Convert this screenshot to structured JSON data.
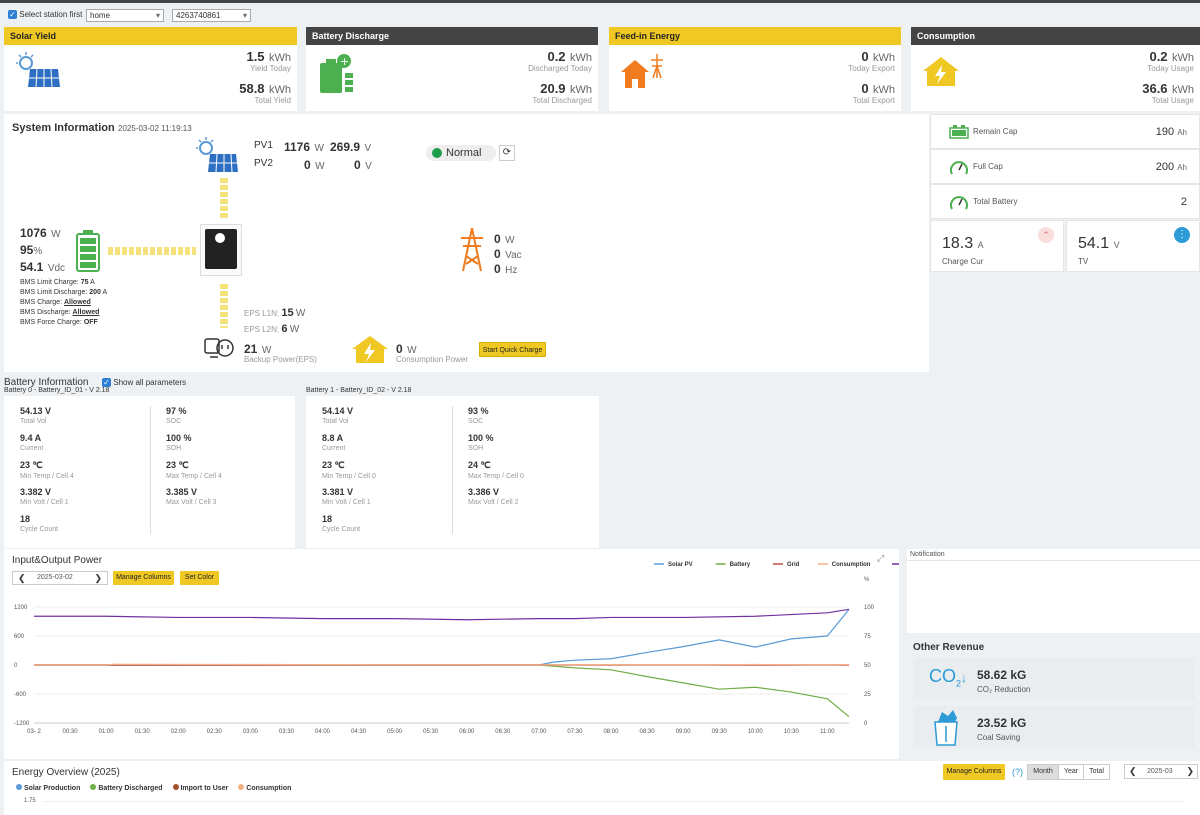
{
  "header": {
    "select_label": "Select station first",
    "station": "home",
    "serial": "4263740861"
  },
  "cards": [
    {
      "title": "Solar Yield",
      "v1": "1.5",
      "u1": "kWh",
      "l1": "Yield Today",
      "v2": "58.8",
      "u2": "kWh",
      "l2": "Total Yield"
    },
    {
      "title": "Battery Discharge",
      "v1": "0.2",
      "u1": "kWh",
      "l1": "Discharged Today",
      "v2": "20.9",
      "u2": "kWh",
      "l2": "Total Discharged"
    },
    {
      "title": "Feed-in Energy",
      "v1": "0",
      "u1": "kWh",
      "l1": "Today Export",
      "v2": "0",
      "u2": "kWh",
      "l2": "Total Export"
    },
    {
      "title": "Consumption",
      "v1": "0.2",
      "u1": "kWh",
      "l1": "Today Usage",
      "v2": "36.6",
      "u2": "kWh",
      "l2": "Total Usage"
    }
  ],
  "system": {
    "title": "System Information",
    "timestamp": "2025-03-02 11:19:13",
    "pv1_label": "PV1",
    "pv1_w": "1176",
    "pv1_v": "269.9",
    "pv2_label": "PV2",
    "pv2_w": "0",
    "pv2_v": "0",
    "w": "W",
    "v": "V",
    "status": "Normal",
    "batt_w": "1076",
    "batt_pct": "95",
    "batt_vdc": "54.1",
    "vdc": "Vdc",
    "pct": "%",
    "bms": [
      {
        "k": "BMS Limit Charge:",
        "v": "75",
        "u": "A"
      },
      {
        "k": "BMS Limit Discharge:",
        "v": "200",
        "u": "A"
      },
      {
        "k": "BMS Charge:",
        "v": "Allowed",
        "u": ""
      },
      {
        "k": "BMS Discharge:",
        "v": "Allowed",
        "u": ""
      },
      {
        "k": "BMS Force Charge:",
        "v": "OFF",
        "u": ""
      }
    ],
    "grid_w": "0",
    "grid_vac": "0",
    "grid_hz": "0",
    "vac": "Vac",
    "hz": "Hz",
    "eps_l1_label": "EPS L1N:",
    "eps_l1": "15",
    "eps_l2_label": "EPS L2N:",
    "eps_l2": "6",
    "backup_w": "21",
    "backup_label": "Backup Power(EPS)",
    "cons_w": "0",
    "cons_label": "Consumption Power",
    "quick_charge": "Start Quick Charge"
  },
  "right_stats": {
    "remain_label": "Remain Cap",
    "remain_val": "190",
    "full_label": "Full Cap",
    "full_val": "200",
    "ah": "Ah",
    "total_label": "Total Battery",
    "total_val": "2",
    "charge_val": "18.3",
    "charge_unit": "A",
    "charge_label": "Charge Cur",
    "tv_val": "54.1",
    "tv_unit": "V",
    "tv_label": "TV"
  },
  "battery_info": {
    "title": "Battery Information",
    "show_all": "Show all parameters",
    "batteries": [
      {
        "name": "Battery 0 - Battery_ID_01 - V 2.18",
        "cells": [
          [
            "54.13 V",
            "Total Vol"
          ],
          [
            "97 %",
            "SOC"
          ],
          [
            "9.4 A",
            "Current"
          ],
          [
            "100 %",
            "SOH"
          ],
          [
            "23 ℃",
            "Min Temp / Cell 4"
          ],
          [
            "23 ℃",
            "Max Temp / Cell 4"
          ],
          [
            "3.382 V",
            "Min Volt / Cell 1"
          ],
          [
            "3.385 V",
            "Max Volt / Cell 3"
          ],
          [
            "18",
            "Cycle Count"
          ]
        ]
      },
      {
        "name": "Battery 1 - Battery_ID_02 - V 2.18",
        "cells": [
          [
            "54.14 V",
            "Total Vol"
          ],
          [
            "93 %",
            "SOC"
          ],
          [
            "8.8 A",
            "Current"
          ],
          [
            "100 %",
            "SOH"
          ],
          [
            "23 ℃",
            "Min Temp / Cell 0"
          ],
          [
            "24 ℃",
            "Max Temp / Cell 0"
          ],
          [
            "3.381 V",
            "Min Volt / Cell 1"
          ],
          [
            "3.386 V",
            "Max Volt / Cell 2"
          ],
          [
            "18",
            "Cycle Count"
          ]
        ]
      }
    ]
  },
  "io_chart": {
    "title": "Input&Output Power",
    "date": "2025-03-02",
    "manage_columns": "Manage Columns",
    "set_color": "Set Color"
  },
  "chart_data": {
    "type": "line",
    "legend": [
      "Solar PV",
      "Battery",
      "Grid",
      "Consumption",
      "SOC"
    ],
    "colors": {
      "Solar PV": "#5b9bd5",
      "Battery": "#70ad47",
      "Grid": "#c0504d",
      "Consumption": "#f4b183",
      "SOC": "#7030a0"
    },
    "left_ticks": [
      "1200",
      "600",
      "0",
      "-600",
      "-1200"
    ],
    "ylim_left": [
      -1200,
      1200
    ],
    "right_unit": "%",
    "right_ticks": [
      "100",
      "75",
      "50",
      "25",
      "0"
    ],
    "ylim_right": [
      0,
      100
    ],
    "x_labels": [
      "03- 2",
      "00:30",
      "01:00",
      "01:30",
      "02:00",
      "02:30",
      "03:00",
      "03:30",
      "04:00",
      "04:30",
      "05:00",
      "05:30",
      "06:00",
      "06:30",
      "07:00",
      "07:30",
      "08:00",
      "08:30",
      "09:00",
      "09:30",
      "10:00",
      "10:30",
      "11:00"
    ],
    "series": [
      {
        "name": "Solar PV",
        "x": [
          0,
          7,
          7.2,
          7.5,
          8,
          8.5,
          9,
          9.5,
          10,
          10.5,
          11,
          11.3
        ],
        "y": [
          0,
          0,
          60,
          100,
          130,
          260,
          380,
          520,
          370,
          540,
          600,
          1150
        ]
      },
      {
        "name": "Battery",
        "x": [
          0,
          7,
          7.5,
          8,
          8.5,
          9,
          9.5,
          10,
          10.5,
          11,
          11.3
        ],
        "y": [
          0,
          0,
          -60,
          -100,
          -240,
          -370,
          -500,
          -460,
          -560,
          -700,
          -1070
        ]
      },
      {
        "name": "Grid",
        "x": [
          0,
          11.3
        ],
        "y": [
          0,
          0
        ]
      },
      {
        "name": "Consumption",
        "x": [
          0,
          1,
          1.1,
          7,
          8,
          9,
          10,
          11,
          11.3
        ],
        "y": [
          0,
          0,
          15,
          0,
          5,
          0,
          10,
          0,
          10
        ]
      },
      {
        "name": "SOC",
        "x": [
          0,
          1,
          2,
          3,
          4,
          5,
          6,
          7,
          7.5,
          8,
          9,
          10,
          11,
          11.3
        ],
        "y": [
          92,
          92,
          91,
          91,
          90,
          90,
          89,
          90,
          90,
          91,
          91,
          92,
          95,
          98
        ]
      }
    ]
  },
  "notification": {
    "title": "Notification"
  },
  "revenue": {
    "title": "Other Revenue",
    "co2_val": "58.62 kG",
    "co2_label": "CO₂ Reduction",
    "coal_val": "23.52 kG",
    "coal_label": "Coal Saving"
  },
  "energy": {
    "title": "Energy Overview (2025)",
    "legend": [
      "Solar Production",
      "Battery Discharged",
      "Import to User",
      "Consumption"
    ],
    "colors": [
      "#5b9bd5",
      "#70ad47",
      "#a0522d",
      "#f4b183"
    ],
    "manage_columns": "Manage Columns",
    "help": "(?)",
    "tabs": [
      "Month",
      "Year",
      "Total"
    ],
    "month": "2025-03",
    "y_first": "1.75"
  }
}
